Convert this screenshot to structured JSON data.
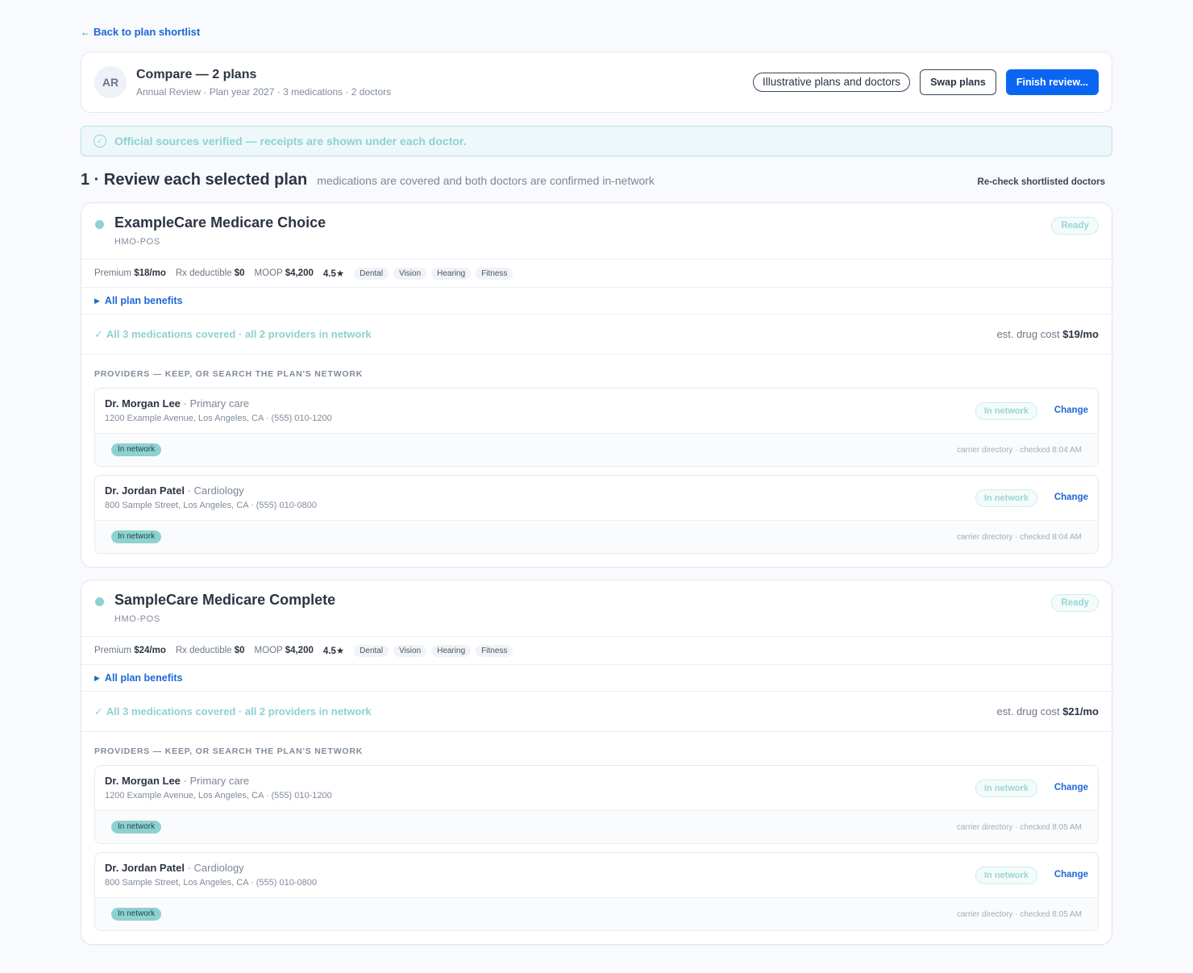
{
  "nav": {
    "back_label": "Back to plan shortlist"
  },
  "header": {
    "avatar_initials": "AR",
    "title": "Compare — 2 plans",
    "subtitle": "Annual Review · Plan year 2027 · 3 medications · 2 doctors",
    "illustrative_label": "Illustrative plans and doctors",
    "swap_label": "Swap plans",
    "finish_label": "Finish review..."
  },
  "banner": {
    "text": "Official sources verified — receipts are shown under each doctor."
  },
  "section": {
    "title": "1 · Review each selected plan",
    "subtitle": "medications are covered and both doctors are confirmed in-network",
    "recheck_label": "Re-check shortlisted doctors"
  },
  "plans": [
    {
      "name": "ExampleCare Medicare Choice",
      "type": "HMO-POS",
      "status": "Ready",
      "premium_label": "Premium",
      "premium": "$18/mo",
      "deductible_label": "Rx deductible",
      "deductible": "$0",
      "moop_label": "MOOP",
      "moop": "$4,200",
      "rating": "4.5★",
      "tags": [
        "Dental",
        "Vision",
        "Hearing",
        "Fitness"
      ],
      "benefits_label": "All plan benefits",
      "coverage_text": "All 3 medications covered · all 2 providers in network",
      "drug_cost_label": "est. drug cost",
      "drug_cost": "$19/mo",
      "providers_heading": "PROVIDERS — KEEP, OR SEARCH THE PLAN'S NETWORK",
      "providers": [
        {
          "name": "Dr. Morgan Lee",
          "specialty": " · Primary care",
          "address": "1200 Example Avenue, Los Angeles, CA · (555) 010-1200",
          "status": "In network",
          "change_label": "Change",
          "chip": "In network",
          "receipt": "carrier directory · checked 8:04 AM"
        },
        {
          "name": "Dr. Jordan Patel",
          "specialty": " · Cardiology",
          "address": "800 Sample Street, Los Angeles, CA · (555) 010-0800",
          "status": "In network",
          "change_label": "Change",
          "chip": "In network",
          "receipt": "carrier directory · checked 8:04 AM"
        }
      ]
    },
    {
      "name": "SampleCare Medicare Complete",
      "type": "HMO-POS",
      "status": "Ready",
      "premium_label": "Premium",
      "premium": "$24/mo",
      "deductible_label": "Rx deductible",
      "deductible": "$0",
      "moop_label": "MOOP",
      "moop": "$4,200",
      "rating": "4.5★",
      "tags": [
        "Dental",
        "Vision",
        "Hearing",
        "Fitness"
      ],
      "benefits_label": "All plan benefits",
      "coverage_text": "All 3 medications covered · all 2 providers in network",
      "drug_cost_label": "est. drug cost",
      "drug_cost": "$21/mo",
      "providers_heading": "PROVIDERS — KEEP, OR SEARCH THE PLAN'S NETWORK",
      "providers": [
        {
          "name": "Dr. Morgan Lee",
          "specialty": " · Primary care",
          "address": "1200 Example Avenue, Los Angeles, CA · (555) 010-1200",
          "status": "In network",
          "change_label": "Change",
          "chip": "In network",
          "receipt": "carrier directory · checked 8:05 AM"
        },
        {
          "name": "Dr. Jordan Patel",
          "specialty": " · Cardiology",
          "address": "800 Sample Street, Los Angeles, CA · (555) 010-0800",
          "status": "In network",
          "change_label": "Change",
          "chip": "In network",
          "receipt": "carrier directory · checked 8:05 AM"
        }
      ]
    }
  ],
  "colors": {
    "accent": "#0a66f2",
    "link": "#1f66d6",
    "teal": "#8dd2d0",
    "text": "#2b3443"
  }
}
